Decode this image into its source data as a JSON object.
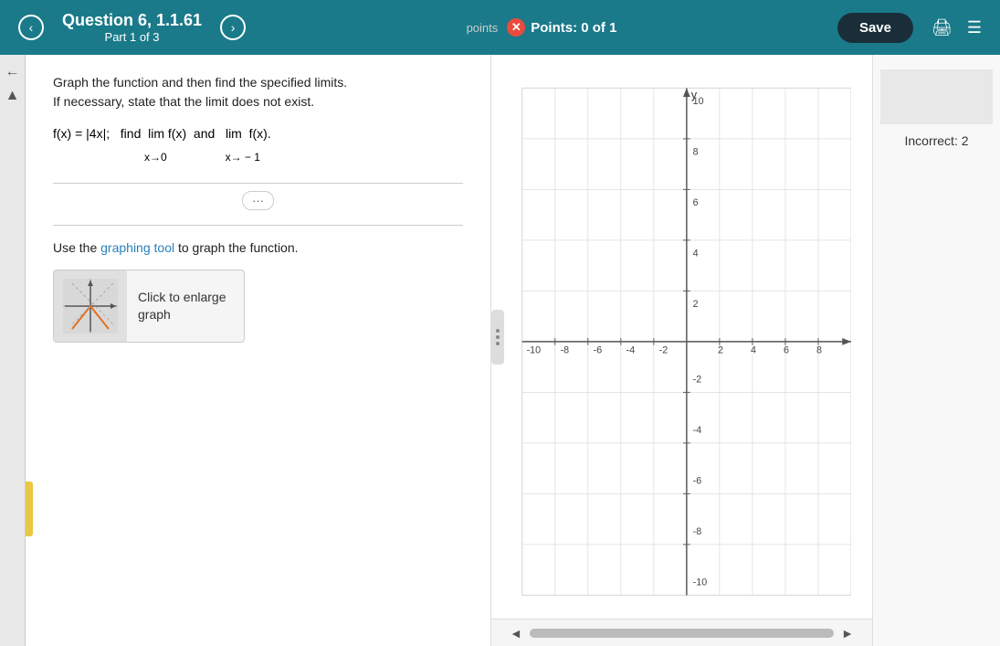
{
  "header": {
    "prev_btn": "‹",
    "next_btn": "›",
    "question_title": "Question 6, 1.1.61",
    "question_part": "Part 1 of 3",
    "points_label": "points",
    "points_value": "Points: 0 of 1",
    "save_label": "Save"
  },
  "left_panel": {
    "instruction_line1": "Graph the function and then find the specified limits.",
    "instruction_line2": "If necessary, state that the limit does not exist.",
    "math_func": "f(x) = |4x|;",
    "math_limit1_label": "find  lim f(x)  and",
    "math_limit1_var": "x→0",
    "math_limit2_label": "lim  f(x).",
    "math_limit2_var": "x→ - 1",
    "ellipsis": "···",
    "graphing_instruction": "Use the graphing tool to graph the function.",
    "click_enlarge": "Click to enlarge graph"
  },
  "right_panel": {
    "grid_x_min": -10,
    "grid_x_max": 10,
    "grid_y_min": -10,
    "grid_y_max": 10,
    "x_labels": [
      "-10",
      "-8",
      "-6",
      "-4",
      "-2",
      "2",
      "4",
      "6",
      "8"
    ],
    "y_labels": [
      "10",
      "8",
      "6",
      "4",
      "2",
      "-2",
      "-4",
      "-6",
      "-8",
      "-10"
    ]
  },
  "right_sidebar": {
    "incorrect_label": "Incorrect: 2"
  },
  "icons": {
    "prev": "‹",
    "next": "›",
    "error": "✕",
    "printer": "🖨",
    "left_arrow": "←",
    "right_arrow": "→",
    "scroll_left": "◄",
    "scroll_right": "►"
  }
}
